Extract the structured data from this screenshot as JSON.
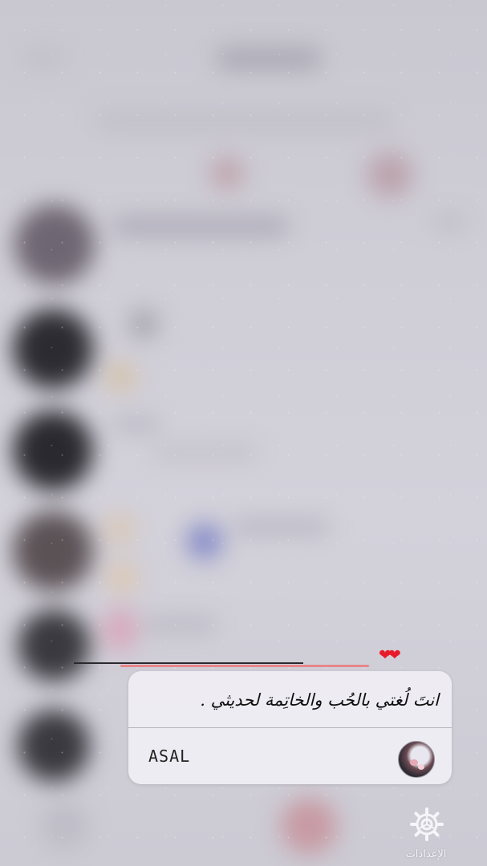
{
  "decoration": {
    "hearts": "❤❤"
  },
  "notification": {
    "quote": "انتَ لُغتي بالحُب والخاتِمة لحديثي .",
    "sender_name": "ASAL"
  },
  "dock": {
    "settings_label": "الإعدادات"
  },
  "colors": {
    "background": "#cfcdd6",
    "card": "#f0eff4",
    "heart": "#e81b2a",
    "accent_line": "#e7878a"
  }
}
